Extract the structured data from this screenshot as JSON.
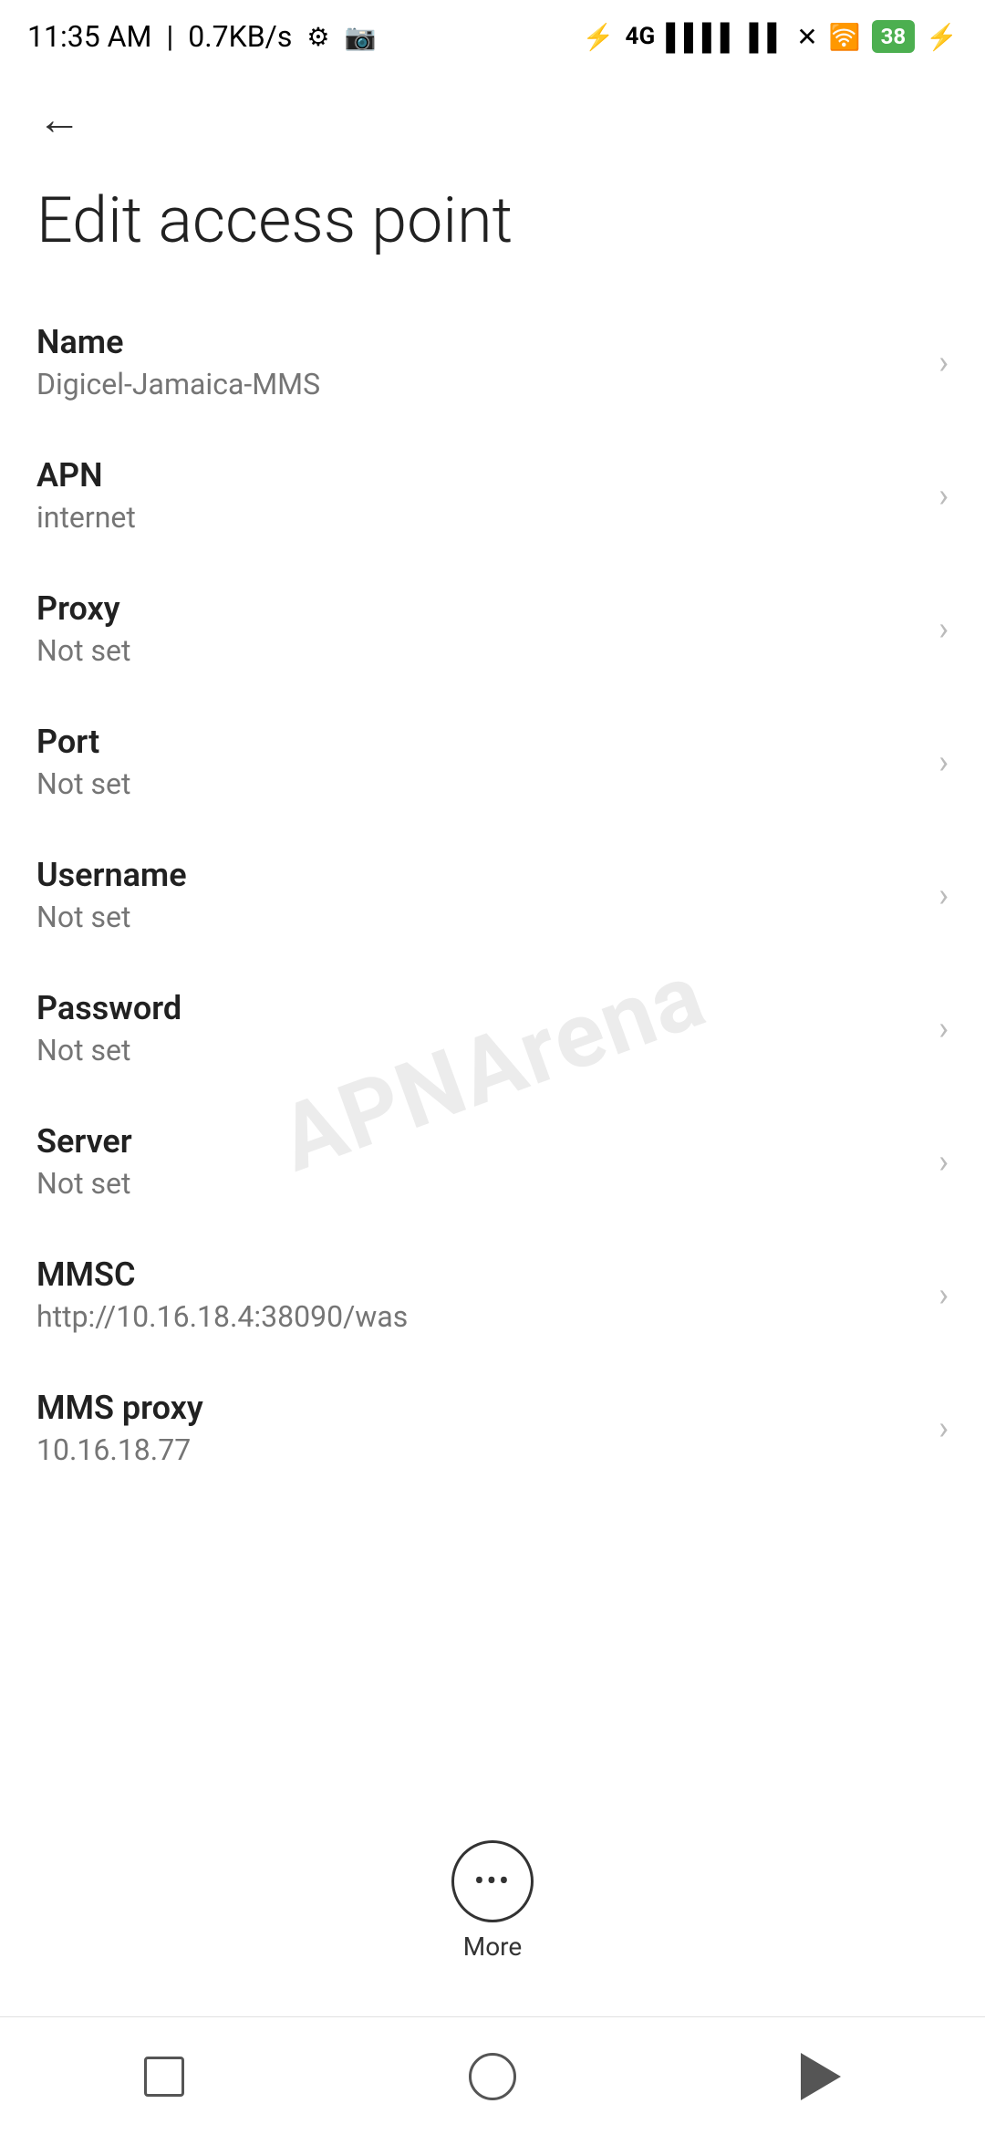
{
  "statusBar": {
    "time": "11:35 AM",
    "speed": "0.7KB/s",
    "battery": "38"
  },
  "toolbar": {
    "backLabel": "←"
  },
  "page": {
    "title": "Edit access point"
  },
  "settings": [
    {
      "label": "Name",
      "value": "Digicel-Jamaica-MMS"
    },
    {
      "label": "APN",
      "value": "internet"
    },
    {
      "label": "Proxy",
      "value": "Not set"
    },
    {
      "label": "Port",
      "value": "Not set"
    },
    {
      "label": "Username",
      "value": "Not set"
    },
    {
      "label": "Password",
      "value": "Not set"
    },
    {
      "label": "Server",
      "value": "Not set"
    },
    {
      "label": "MMSC",
      "value": "http://10.16.18.4:38090/was"
    },
    {
      "label": "MMS proxy",
      "value": "10.16.18.77"
    }
  ],
  "more": {
    "label": "More"
  },
  "watermark": "APNArena"
}
